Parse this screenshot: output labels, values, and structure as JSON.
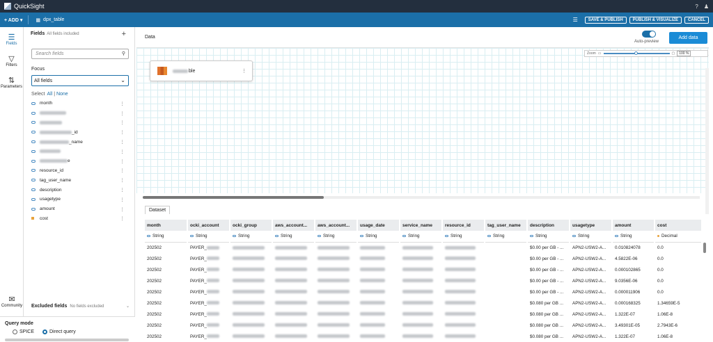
{
  "app": {
    "title": "QuickSight"
  },
  "toolbar": {
    "add": "+ ADD",
    "dataset": "dpx_table",
    "save_publish": "SAVE & PUBLISH",
    "publish_visualize": "PUBLISH & VISUALIZE",
    "cancel": "CANCEL"
  },
  "rail": {
    "fields": "Fields",
    "filters": "Filters",
    "parameters": "Parameters",
    "community": "Community"
  },
  "fields_panel": {
    "title": "Fields",
    "subtitle": "All fields included",
    "search_placeholder": "Search fields",
    "focus_label": "Focus",
    "focus_value": "All fields",
    "select_label": "Select",
    "select_all": "All",
    "select_none": "None",
    "items": [
      {
        "label": "month",
        "type": "string"
      },
      {
        "label": "",
        "type": "string",
        "blurred": true
      },
      {
        "label": "",
        "type": "string",
        "blurred": true
      },
      {
        "label": "_id",
        "type": "string",
        "blurred": true
      },
      {
        "label": "_name",
        "type": "string",
        "blurred": true
      },
      {
        "label": "",
        "type": "string",
        "blurred": true
      },
      {
        "label": "e",
        "type": "string",
        "blurred": true
      },
      {
        "label": "resource_id",
        "type": "string"
      },
      {
        "label": "tag_user_name",
        "type": "string"
      },
      {
        "label": "description",
        "type": "string"
      },
      {
        "label": "usagetype",
        "type": "string"
      },
      {
        "label": "amount",
        "type": "string"
      },
      {
        "label": "cost",
        "type": "decimal"
      }
    ],
    "excluded_title": "Excluded fields",
    "excluded_subtitle": "No fields excluded"
  },
  "query_mode": {
    "title": "Query mode",
    "spice": "SPICE",
    "direct": "Direct query",
    "selected": "Direct query"
  },
  "main": {
    "data_label": "Data",
    "auto_preview": "Auto-preview",
    "add_data": "Add data",
    "zoom_label": "Zoom",
    "zoom_value": "100 %",
    "card_label": "ble",
    "dataset_tab": "Dataset"
  },
  "table": {
    "columns": [
      "month",
      "ocki_account",
      "ocki_group",
      "aws_account...",
      "aws_account...",
      "usage_date",
      "service_name",
      "resource_id",
      "tag_user_name",
      "description",
      "usagetype",
      "amount",
      "cost"
    ],
    "types": [
      "String",
      "String",
      "String",
      "String",
      "String",
      "String",
      "String",
      "String",
      "String",
      "String",
      "String",
      "String",
      "Decimal"
    ],
    "rows": [
      [
        "202502",
        "PAYER_",
        "",
        "",
        "",
        "",
        "",
        "",
        "",
        "$0.00 per GB - ...",
        "APN2-USW2-A...",
        "0.010824078",
        "0.0"
      ],
      [
        "202502",
        "PAYER_",
        "",
        "",
        "",
        "",
        "",
        "",
        "",
        "$0.00 per GB - ...",
        "APN2-USW2-A...",
        "4.5822E-06",
        "0.0"
      ],
      [
        "202502",
        "PAYER_",
        "",
        "",
        "",
        "",
        "",
        "",
        "",
        "$0.00 per GB - ...",
        "APN2-USW2-A...",
        "0.000102865",
        "0.0"
      ],
      [
        "202502",
        "PAYER_",
        "",
        "",
        "",
        "",
        "",
        "",
        "",
        "$0.00 per GB - ...",
        "APN2-USW2-A...",
        "9.0356E-06",
        "0.0"
      ],
      [
        "202502",
        "PAYER_",
        "",
        "",
        "",
        "",
        "",
        "",
        "",
        "$0.00 per GB - ...",
        "APN2-USW2-A...",
        "0.000011906",
        "0.0"
      ],
      [
        "202502",
        "PAYER_",
        "",
        "",
        "",
        "",
        "",
        "",
        "",
        "$0.080 per GB ...",
        "APN2-USW2-A...",
        "0.000168325",
        "1.34659E-5"
      ],
      [
        "202502",
        "PAYER_",
        "",
        "",
        "",
        "",
        "",
        "",
        "",
        "$0.080 per GB ...",
        "APN2-USW2-A...",
        "1.322E-07",
        "1.06E-8"
      ],
      [
        "202502",
        "PAYER_",
        "",
        "",
        "",
        "",
        "",
        "",
        "",
        "$0.080 per GB ...",
        "APN2-USW2-A...",
        "3.49301E-05",
        "2.7943E-6"
      ],
      [
        "202502",
        "PAYER_",
        "",
        "",
        "",
        "",
        "",
        "",
        "",
        "$0.080 per GB ...",
        "APN2-USW2-A...",
        "1.322E-07",
        "1.06E-8"
      ]
    ]
  },
  "colors": {
    "topbar": "#232f3e",
    "toolbar": "#1b6fa8",
    "accent": "#1a8bd6",
    "decimal": "#e8a33d"
  }
}
